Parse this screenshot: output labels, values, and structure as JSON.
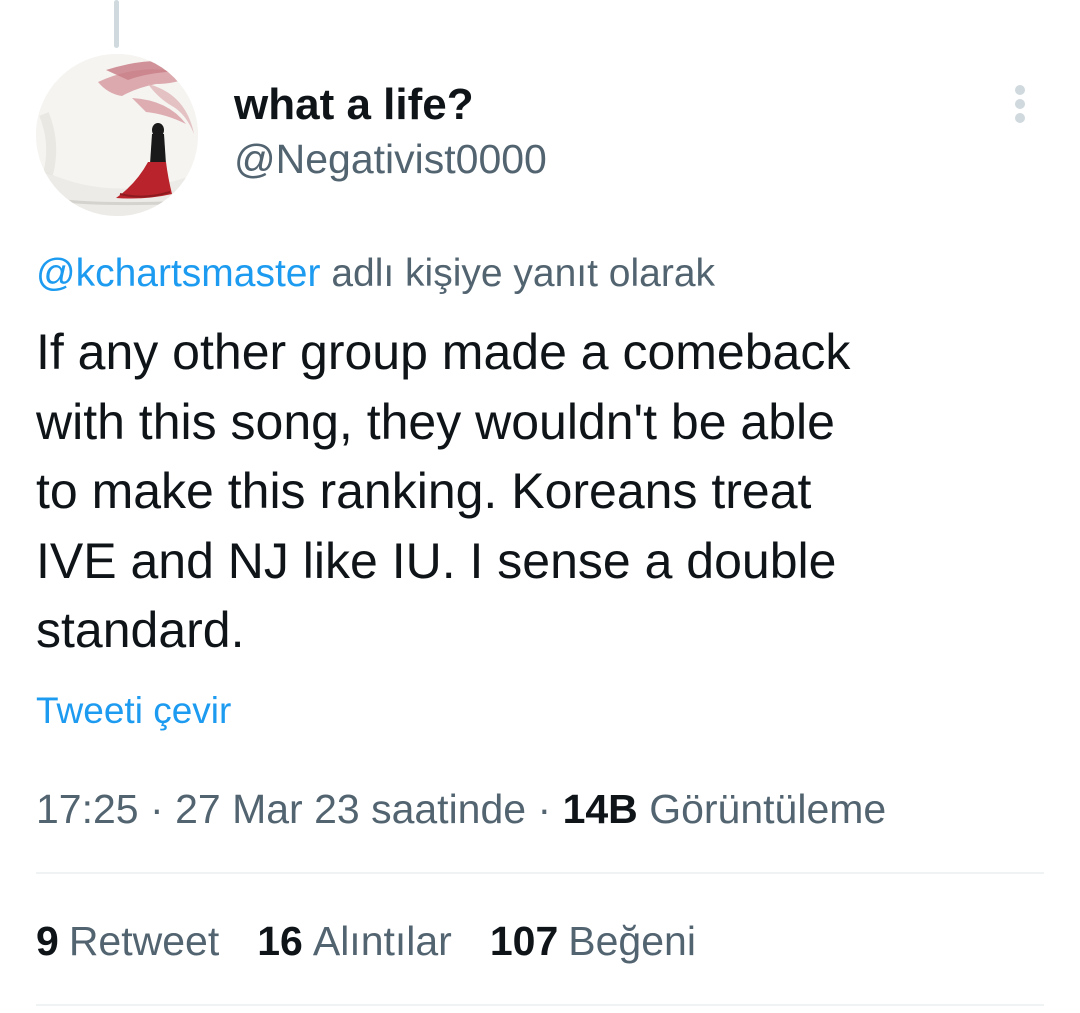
{
  "tweet": {
    "display_name": "what a life?",
    "handle": "@Negativist0000",
    "reply_to": {
      "handle": "@kchartsmaster",
      "suffix": "adlı kişiye yanıt olarak"
    },
    "text": "If any other group made a comeback\nwith this song, they wouldn't be able\nto make this ranking.  Koreans treat\nIVE and NJ like IU.  I sense a double\nstandard.",
    "translate_label": "Tweeti çevir",
    "time": "17:25",
    "separator": "·",
    "date": "27 Mar 23 saatinde",
    "views_count": "14B",
    "views_label": "Görüntüleme"
  },
  "stats": {
    "retweets": {
      "count": "9",
      "label": "Retweet"
    },
    "quotes": {
      "count": "16",
      "label": "Alıntılar"
    },
    "likes": {
      "count": "107",
      "label": "Beğeni"
    }
  },
  "icons": {
    "more": "more-vertical-icon",
    "avatar": "avatar-illustration"
  },
  "colors": {
    "accent": "#1d9bf0",
    "text_primary": "#0f1419",
    "text_secondary": "#536471",
    "divider": "#eff3f4",
    "more_icon": "#cfd9de"
  }
}
